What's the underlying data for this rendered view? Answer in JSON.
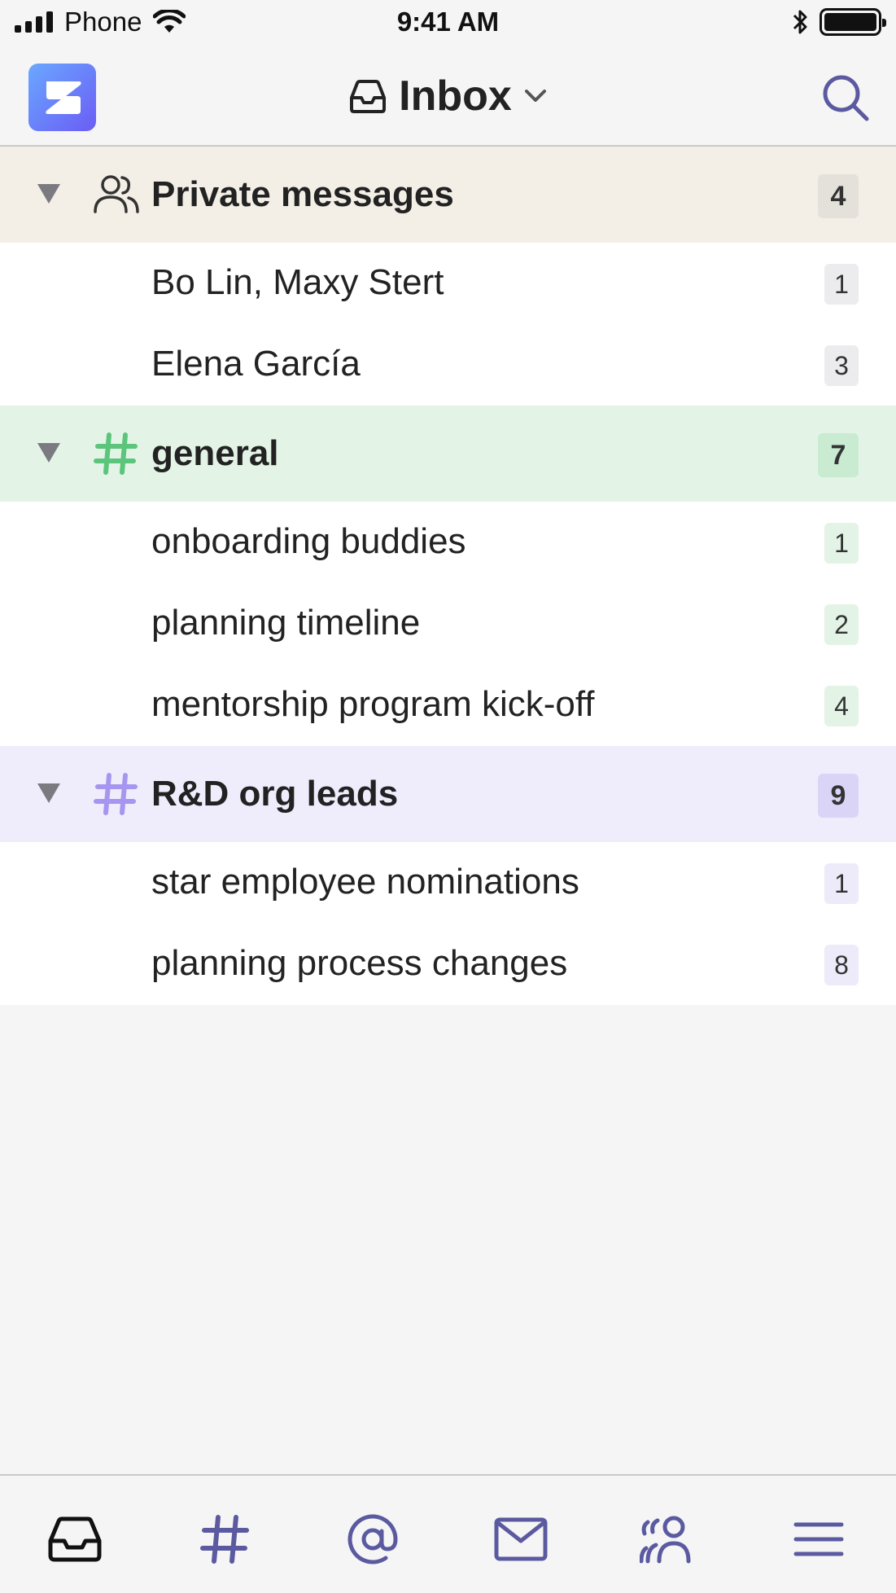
{
  "status_bar": {
    "carrier": "Phone",
    "time": "9:41 AM"
  },
  "header": {
    "title": "Inbox"
  },
  "colors": {
    "brand": "#6b5cf5",
    "nav_icon": "#5b5aa0",
    "active_icon": "#111111"
  },
  "groups": [
    {
      "name": "Private messages",
      "icon": "users-icon",
      "count": "4",
      "header_bg": "#f3efe6",
      "badge_bg": "#e4e1da",
      "rows": [
        {
          "name": "Bo Lin, Maxy Stert",
          "count": "1",
          "badge_bg": "#ececef"
        },
        {
          "name": "Elena García",
          "count": "3",
          "badge_bg": "#ececef"
        }
      ]
    },
    {
      "name": "general",
      "icon": "hashtag-icon",
      "color": "#5bc57c",
      "count": "7",
      "header_bg": "#e3f4e6",
      "badge_bg": "#c8ebd1",
      "rows": [
        {
          "name": "onboarding buddies",
          "count": "1",
          "badge_bg": "#e3f4e6"
        },
        {
          "name": "planning timeline",
          "count": "2",
          "badge_bg": "#e3f4e6"
        },
        {
          "name": "mentorship program kick-off",
          "count": "4",
          "badge_bg": "#e3f4e6"
        }
      ]
    },
    {
      "name": "R&D org leads",
      "icon": "hashtag-icon",
      "color": "#a696f0",
      "count": "9",
      "header_bg": "#efedfc",
      "badge_bg": "#dad5f7",
      "rows": [
        {
          "name": "star employee nominations",
          "count": "1",
          "badge_bg": "#edebfa"
        },
        {
          "name": "planning process changes",
          "count": "8",
          "badge_bg": "#edebfa"
        }
      ]
    }
  ],
  "bottom_nav": [
    "inbox-icon",
    "channels-icon",
    "mentions-icon",
    "direct-messages-icon",
    "users-icon",
    "menu-icon"
  ]
}
